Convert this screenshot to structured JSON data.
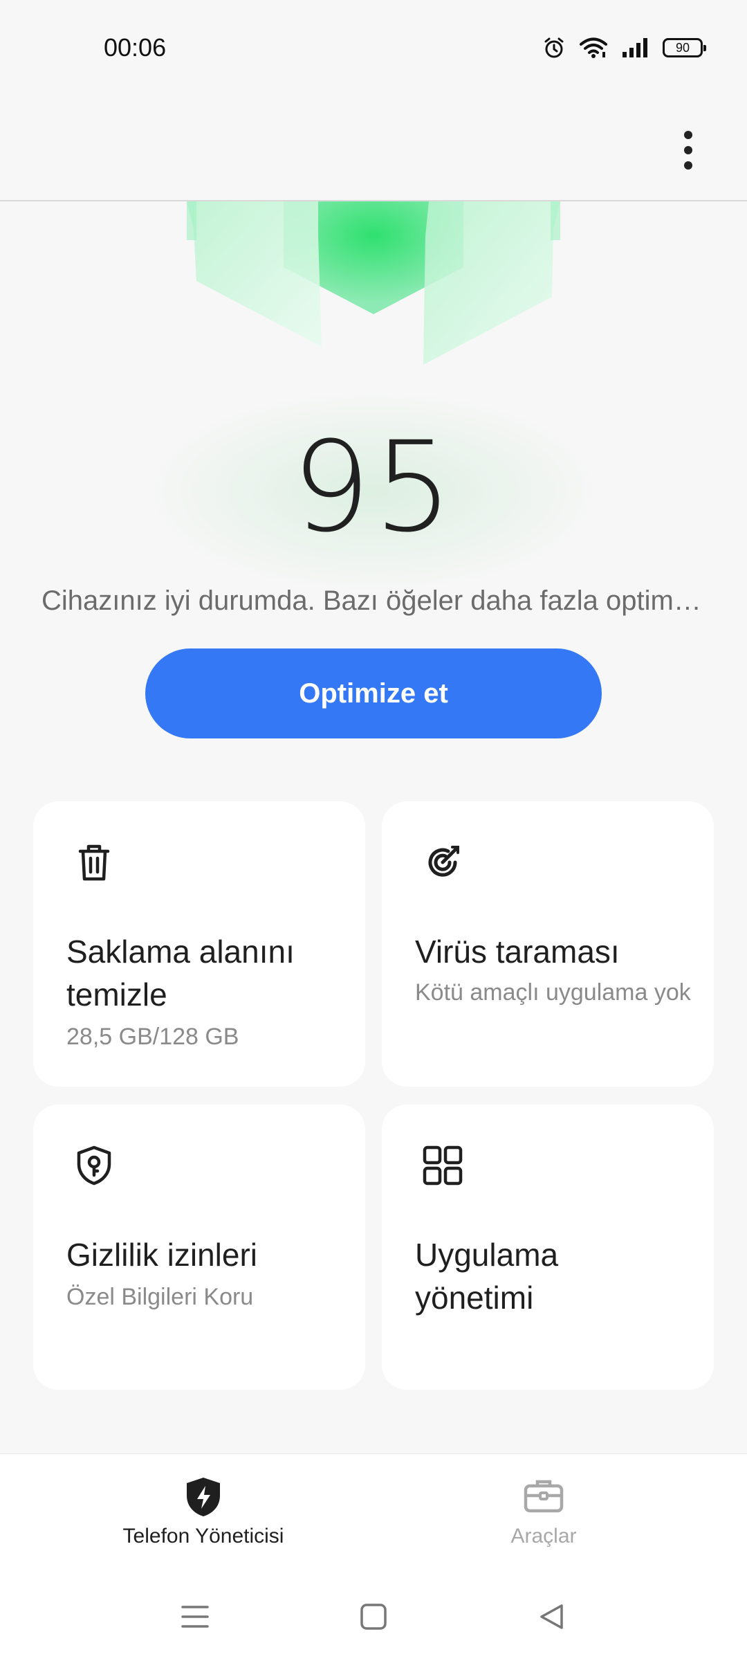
{
  "status_bar": {
    "time": "00:06",
    "battery_level": "90",
    "icons": [
      "alarm-icon",
      "wifi-icon",
      "signal-icon",
      "battery-icon"
    ]
  },
  "toolbar": {
    "more_icon": "more-vert-icon"
  },
  "score": {
    "value": "95",
    "message": "Cihazınız iyi durumda. Bazı öğeler daha fazla optimize edilebilir."
  },
  "optimize_button": {
    "label": "Optimize et"
  },
  "cards": [
    {
      "icon": "trash-icon",
      "title": "Saklama alanını temizle",
      "subtitle": "28,5 GB/128 GB"
    },
    {
      "icon": "target-icon",
      "title": "Virüs taraması",
      "subtitle": "Kötü amaçlı uygulama yok"
    },
    {
      "icon": "shield-key-icon",
      "title": "Gizlilik izinleri",
      "subtitle": "Özel Bilgileri Koru"
    },
    {
      "icon": "apps-grid-icon",
      "title": "Uygulama yönetimi",
      "subtitle": ""
    }
  ],
  "bottom_nav": {
    "items": [
      {
        "label": "Telefon Yöneticisi",
        "icon": "shield-bolt-icon",
        "active": true
      },
      {
        "label": "Araçlar",
        "icon": "toolbox-icon",
        "active": false
      }
    ]
  },
  "colors": {
    "accent": "#3478f6",
    "background": "#f7f7f7",
    "illustration_green": "#3ee07a"
  }
}
